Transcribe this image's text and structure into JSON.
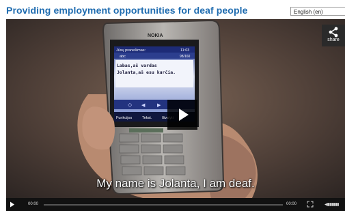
{
  "page": {
    "title": "Providing employment opportunities for deaf people",
    "language_selected": "English (en)"
  },
  "video": {
    "subtitle": "My name is Jolanta, I am deaf.",
    "share_label": "share",
    "current_time": "00:00",
    "duration": "00:00",
    "volume_glyph": "▮▮▮▮▮▮",
    "phone": {
      "brand": "NOKIA",
      "screen_header": "Jūsų pranešimas:",
      "screen_time": "11:03",
      "screen_line2": "abc",
      "screen_counter": "98/160",
      "message_line1": "Labas,aš vardas",
      "message_line2": "Jolanta,aš esu kurčia.",
      "softkey_1": "Funkcijos",
      "softkey_2": "Tekst.",
      "softkey_3": "Išvalyti"
    }
  }
}
